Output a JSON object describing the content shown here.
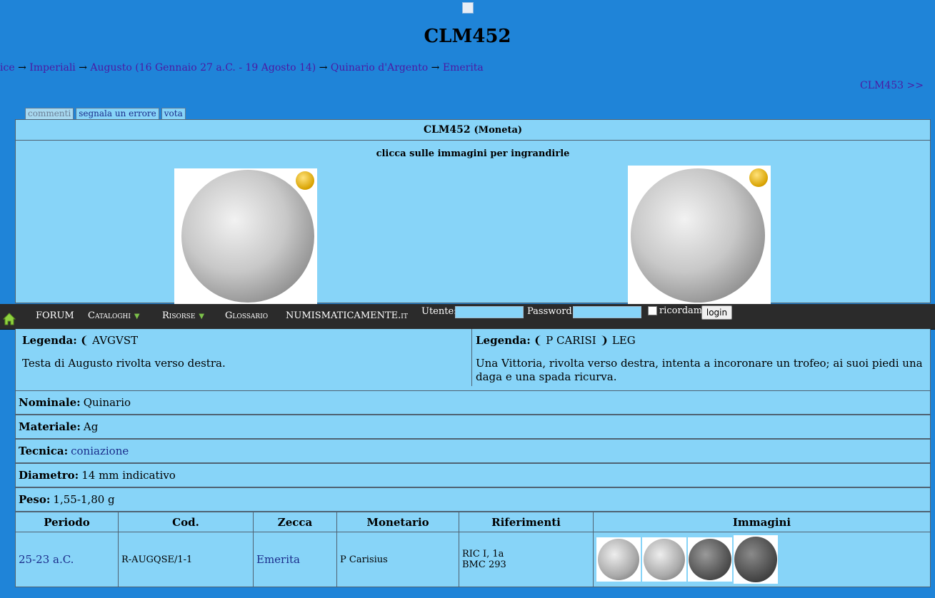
{
  "page": {
    "title": "CLM452",
    "next_link": "CLM453 >>"
  },
  "breadcrumb": [
    {
      "label": "ice",
      "link": true
    },
    {
      "label": "Imperiali",
      "link": true
    },
    {
      "label": "Augusto (16 Gennaio 27 a.C. - 19 Agosto 14)",
      "link": true
    },
    {
      "label": "Quinario d'Argento",
      "link": true
    },
    {
      "label": "Emerita",
      "link": true
    }
  ],
  "breadcrumb_separator": "→",
  "tabs": [
    "commenti",
    "segnala un errore",
    "vota"
  ],
  "panel": {
    "title": "CLM452",
    "subtitle": "(Moneta)",
    "hint": "clicca sulle immagini per ingrandirle"
  },
  "navbar": {
    "items": [
      {
        "label": "FORUM",
        "dropdown": false
      },
      {
        "label": "Cataloghi",
        "dropdown": true
      },
      {
        "label": "Risorse",
        "dropdown": true
      },
      {
        "label": "Glossario",
        "dropdown": false
      },
      {
        "label": "NUMISMATICAMENTE.it",
        "dropdown": false
      }
    ],
    "user_label": "Utente:",
    "password_label": "Password:",
    "remember_label": "ricordami",
    "login_button": "login",
    "icon_chevron": "chevron-down-icon",
    "icon_home": "home-icon"
  },
  "obverse": {
    "legend_label": "Legenda:",
    "legend_value": "❨ AVGVST",
    "description": "Testa di Augusto rivolta verso destra."
  },
  "reverse": {
    "legend_label": "Legenda:",
    "legend_value": "❨ P CARISI ❩ LEG",
    "description": "Una Vittoria, rivolta verso destra, intenta a incoronare un trofeo; ai suoi piedi una daga e una spada ricurva."
  },
  "details": {
    "nominale_label": "Nominale:",
    "nominale_value": "Quinario",
    "materiale_label": "Materiale:",
    "materiale_value": "Ag",
    "tecnica_label": "Tecnica:",
    "tecnica_value": "coniazione",
    "diametro_label": "Diametro:",
    "diametro_value": "14 mm indicativo",
    "peso_label": "Peso:",
    "peso_value": "1,55-1,80 g"
  },
  "table": {
    "headers": [
      "Periodo",
      "Cod.",
      "Zecca",
      "Monetario",
      "Riferimenti",
      "Immagini"
    ],
    "row": {
      "periodo": "25-23 a.C.",
      "cod": "R-AUGQSE/1-1",
      "zecca": "Emerita",
      "monetario": "P Carisius",
      "ref1": "RIC I, 1a",
      "ref2": "BMC 293"
    }
  }
}
